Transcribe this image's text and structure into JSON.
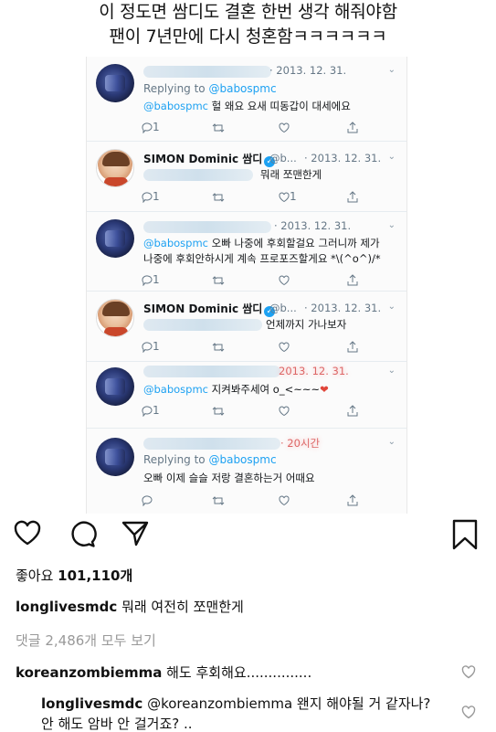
{
  "caption": {
    "line1": "이 정도면 쌈디도 결혼 한번 생각 해줘야함",
    "line2": "팬이 7년만에 다시 청혼함ㅋㅋㅋㅋㅋㅋ"
  },
  "tweets": [
    {
      "date": "· 2013. 12. 31.",
      "reply_prefix": "Replying to ",
      "reply_handle": "@babospmc",
      "mention": "@babospmc",
      "text": " 헐 왜요 요새 띠동갑이 대세에요",
      "reply_count": "1"
    },
    {
      "name": "SIMON Dominic 쌈디",
      "handle": "@b...",
      "date": "· 2013. 12. 31.",
      "text": "뭐래 쪼맨한게",
      "reply_count": "1",
      "like_count": "1"
    },
    {
      "date": "· 2013. 12. 31.",
      "mention": "@babospmc",
      "text": " 오빠 나중에 후회할걸요 그러니까 제가",
      "text2": "나중에 후회안하시게 계속 프로포즈할게요 *\\(^o^)/*",
      "reply_count": "1"
    },
    {
      "name": "SIMON Dominic 쌈디",
      "handle": "@b...",
      "date": "· 2013. 12. 31.",
      "text": "언제까지 가나보자",
      "reply_count": "1"
    },
    {
      "date": "2013. 12. 31.",
      "mention": "@babospmc",
      "text": " 지켜봐주세여 o_<~~~",
      "heart": "❤",
      "reply_count": "1"
    },
    {
      "date": "· 20시간",
      "reply_prefix": "Replying to ",
      "reply_handle": "@babospmc",
      "text": "오빠 이제 슬슬 저랑 결혼하는거 어때요"
    }
  ],
  "post": {
    "likes_label": "좋아요 ",
    "likes_count": "101,110개",
    "author": "longlivesmdc",
    "caption_text": " 뭐래 여전히 쪼맨한게",
    "view_all": "댓글 2,486개 모두 보기",
    "comment_user": "koreanzombiemma",
    "comment_text": " 해도 후회해요...............",
    "reply_user": "longlivesmdc",
    "reply_mention": " @koreanzombiemma",
    "reply_text": " 왠지 해야될 거 같자나? 안 해도 암바 안 걸거죠? .."
  }
}
